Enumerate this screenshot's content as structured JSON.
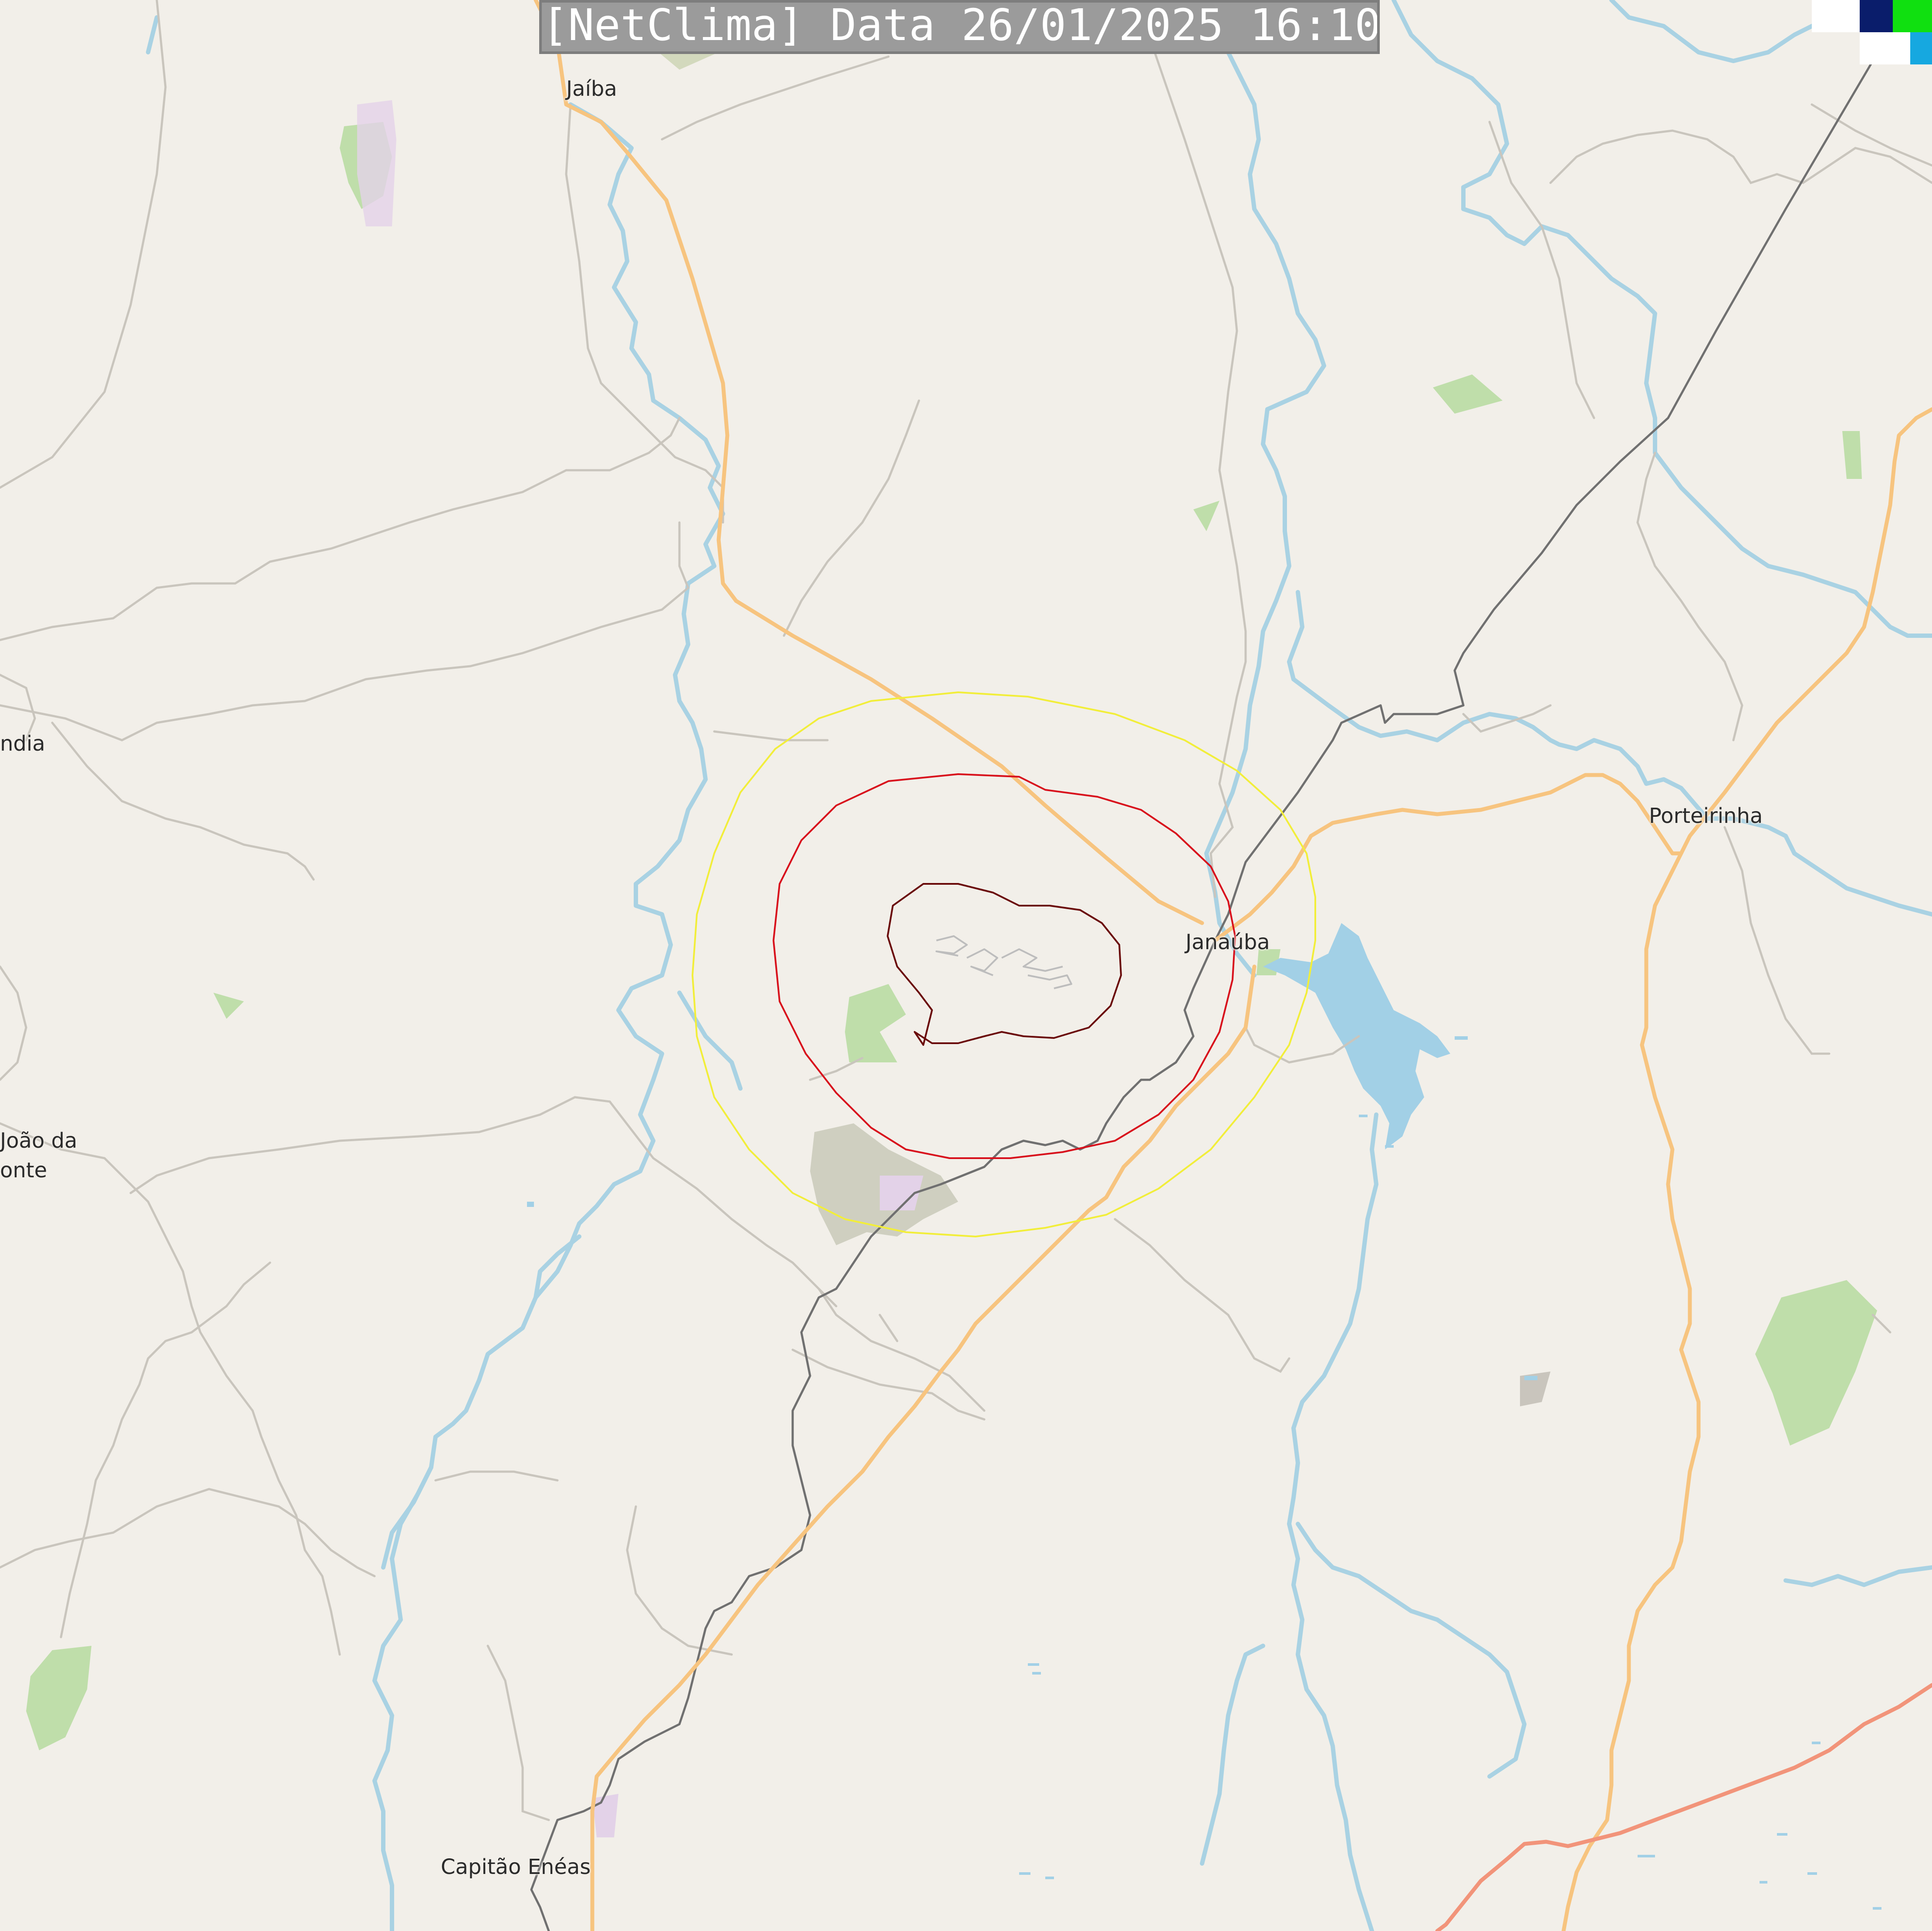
{
  "title": "[NetClima] Data 26/01/2025 16:10:00",
  "places": {
    "jaiba": "Jaíba",
    "manga_partial": "ndia",
    "sao_joao_line1": "João da",
    "sao_joao_line2": "onte",
    "janauba": "Janaúba",
    "porteirinha": "Porteirinha",
    "capitao_eneas": "Capitão Enéas"
  },
  "legend_colors": [
    "#ffffff",
    "#0a1d6b",
    "#10e010",
    "#ffffff",
    "#16a8e0"
  ],
  "contour_colors": {
    "outer": "#f2ee3a",
    "middle": "#d8101c",
    "inner": "#6a0a0a"
  },
  "map_colors": {
    "land": "#f2efe9",
    "river": "#a9d2e3",
    "primary_road": "#f7c47f",
    "trunk_road": "#f2947a",
    "minor_road": "#c9c5bd",
    "railway": "#707070",
    "farmland": "#b9dca3",
    "urban": "#e3d2e8",
    "reservoir": "#a2d0e6"
  }
}
